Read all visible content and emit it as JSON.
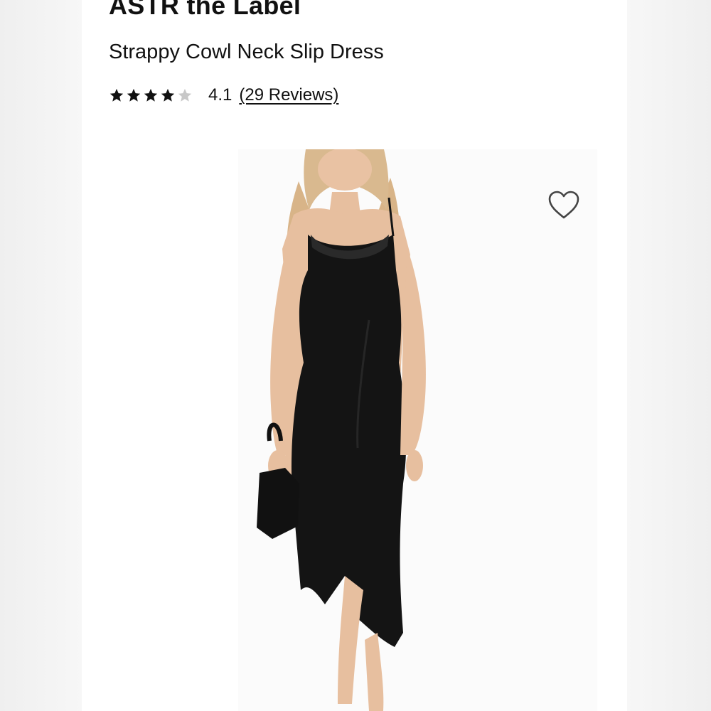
{
  "product": {
    "brand": "ASTR the Label",
    "name": "Strappy Cowl Neck Slip Dress"
  },
  "rating": {
    "stars_filled": 4,
    "stars_total": 5,
    "value": "4.1",
    "reviews_label": "(29 Reviews)"
  },
  "image": {
    "subject": "model in black satin slip dress holding small black handbag"
  },
  "icons": {
    "wishlist": "heart-outline-icon",
    "star_filled": "star-filled-icon",
    "star_empty": "star-empty-icon"
  },
  "colors": {
    "text": "#111111",
    "star_filled": "#111111",
    "star_empty": "#c8c8c8",
    "dress": "#141414",
    "background": "#ffffff"
  }
}
